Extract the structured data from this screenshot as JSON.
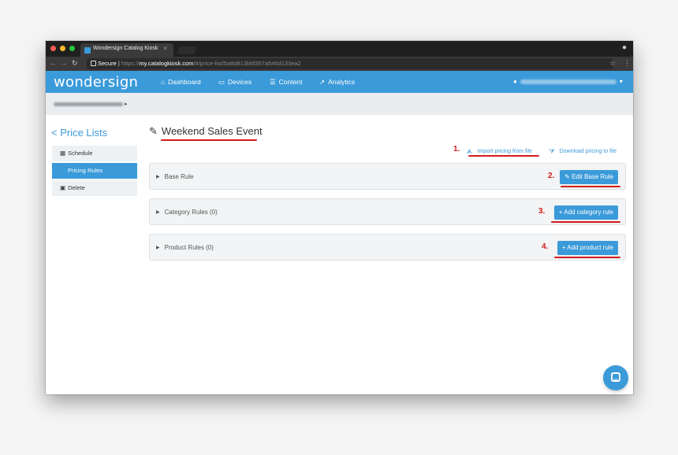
{
  "browser": {
    "tab_title": "Wondersign Catalog Kiosk",
    "tab_close": "×",
    "secure_label": "Secure",
    "url_scheme": "https://",
    "url_host": "my.catalogkiosk.com",
    "url_path": "/#/price-list/5a8d813b6f357a546d133ea2"
  },
  "app": {
    "logo": "wondersign",
    "nav": [
      {
        "label": "Dashboard",
        "icon": "home-icon"
      },
      {
        "label": "Devices",
        "icon": "monitor-icon"
      },
      {
        "label": "Content",
        "icon": "list-icon"
      },
      {
        "label": "Analytics",
        "icon": "line-chart-icon"
      }
    ]
  },
  "sidebar": {
    "back_label": "< Price Lists",
    "items": [
      {
        "label": "Schedule",
        "icon": "calendar-icon"
      },
      {
        "label": "Pricing Rules"
      },
      {
        "label": "Delete",
        "icon": "trash-icon"
      }
    ]
  },
  "page": {
    "title": "Weekend Sales Event",
    "import_label": "Import pricing from file",
    "download_label": "Download pricing to file"
  },
  "panels": [
    {
      "label": "Base Rule",
      "button": "✎ Edit Base Rule"
    },
    {
      "label": "Category Rules (0)",
      "button": "+ Add category rule"
    },
    {
      "label": "Product Rules (0)",
      "button": "+ Add product rule"
    }
  ],
  "annotations": [
    "1.",
    "2.",
    "3.",
    "4."
  ],
  "colors": {
    "accent": "#3b9ad9",
    "annotation": "#d31b1b"
  }
}
